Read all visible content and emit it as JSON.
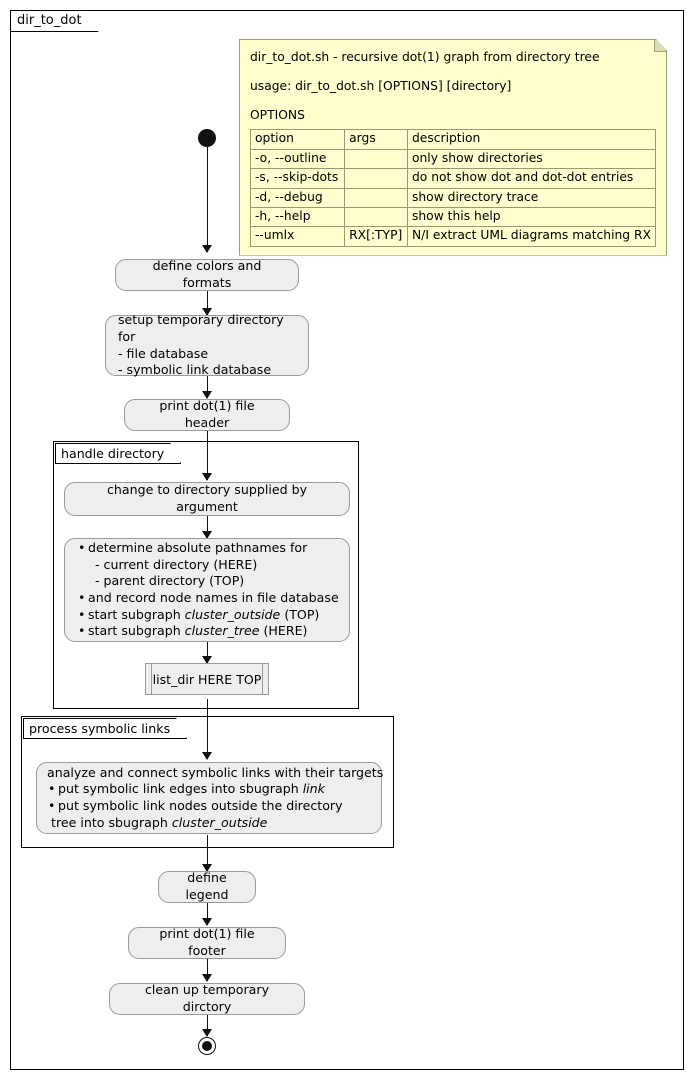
{
  "diagram": {
    "frame_title": "dir_to_dot"
  },
  "note": {
    "heading": "dir_to_dot.sh - recursive dot(1) graph from directory tree",
    "usage": "usage: dir_to_dot.sh [OPTIONS] [directory]",
    "options_label": "OPTIONS",
    "table": {
      "headers": [
        "option",
        "args",
        "description"
      ],
      "rows": [
        [
          "-o, --outline",
          "",
          "only show directories"
        ],
        [
          "-s, --skip-dots",
          "",
          "do not show dot and dot-dot entries"
        ],
        [
          "-d, --debug",
          "",
          "show directory trace"
        ],
        [
          "-h, --help",
          "",
          "show this help"
        ],
        [
          "--umlx",
          "RX[:TYP]",
          "N/I extract UML diagrams matching RX"
        ]
      ]
    }
  },
  "flow": {
    "start_node": "start",
    "end_node": "end",
    "activities": {
      "define_colors": "define colors and formats",
      "setup_tmp": "setup temporary directory for\n- file database\n- symbolic link database",
      "print_header": "print dot(1) file header",
      "change_dir": "change to directory supplied by argument",
      "determine_paths": {
        "lines": [
          "determine absolute pathnames for",
          "- current directory (HERE)",
          "- parent directory (TOP)",
          "and record node names in file database",
          "start subgraph cluster_outside (TOP)",
          "start subgraph cluster_tree (HERE)"
        ],
        "l1": "determine absolute pathnames for",
        "l2": " - current directory (HERE)",
        "l3": " - parent directory (TOP)",
        "l4": "and record node names in file database",
        "l5a": "start subgraph ",
        "l5b": "cluster_outside",
        "l5c": " (TOP)",
        "l6a": "start subgraph ",
        "l6b": "cluster_tree",
        "l6c": " (HERE)"
      },
      "list_dir": "list_dir HERE TOP",
      "symlinks": {
        "l1": "analyze and connect symbolic links with their targets",
        "l2a": "put symbolic link edges into sbugraph ",
        "l2b": "link",
        "l3": "put symbolic link nodes outside the directory",
        "l4a": " tree into sbugraph ",
        "l4b": "cluster_outside"
      },
      "define_legend": "define legend",
      "print_footer": "print dot(1) file footer",
      "clean_up": "clean up temporary dirctory"
    },
    "partitions": {
      "handle_directory": "handle directory",
      "process_symbolic_links": "process symbolic links"
    }
  },
  "colors": {
    "note_fill": "#FEFECE",
    "note_border": "#A0A070",
    "activity_fill": "#EEEEEE",
    "activity_border": "#9A9A9A",
    "line": "#111111",
    "background": "#FFFFFF"
  }
}
